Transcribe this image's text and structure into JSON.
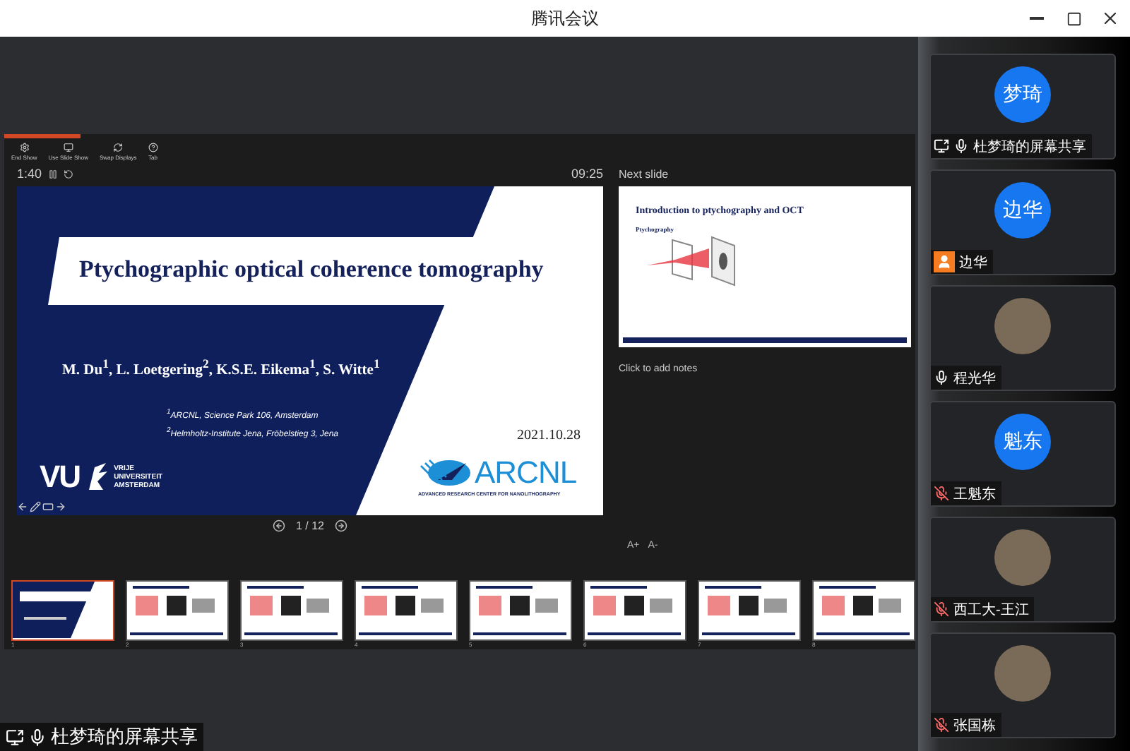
{
  "window": {
    "title": "腾讯会议"
  },
  "presenter": {
    "progress": {
      "level": 0.083
    },
    "toolbar": [
      {
        "label": "End Show",
        "kind": "gear"
      },
      {
        "label": "Use Slide Show",
        "kind": "screen"
      },
      {
        "label": "Swap Displays",
        "kind": "swap"
      },
      {
        "label": "Tab",
        "kind": "info"
      }
    ],
    "elapsed": "1:40",
    "clock": "09:25",
    "slide": {
      "title": "Ptychographic optical coherence tomography",
      "authors": "M. Du$^{1}$, L. Loetgering$^{2}$, K.S.E. Eikema$^{1}$, S. Witte$^{1}$",
      "affiliations": [
        "$^{1}$ARCNL, Science Park 106, Amsterdam",
        "$^{2}$Helmholtz-Institute Jena, Fröbelstieg 3, Jena"
      ],
      "date": "2021.10.28",
      "vu_logo": {
        "mark": "VU",
        "words": [
          "VRIJE",
          "UNIVERSITEIT",
          "AMSTERDAM"
        ]
      },
      "arcnl_logo": {
        "mark": "ARCNL",
        "tagline": "ADVANCED RESEARCH CENTER FOR NANOLITHOGRAPHY"
      }
    },
    "slide_counter": "1 / 12",
    "next_slide": {
      "heading": "Next slide",
      "title": "Introduction to ptychography and OCT",
      "subtitle": "Ptychography"
    },
    "notes": {
      "placeholder": "Click to add notes"
    },
    "text_size_buttons": [
      "A+",
      "A-"
    ],
    "thumbnails": [
      {
        "number": "1",
        "selected": true,
        "kind": "title"
      },
      {
        "number": "2",
        "selected": false,
        "kind": "content"
      },
      {
        "number": "3",
        "selected": false,
        "kind": "content"
      },
      {
        "number": "4",
        "selected": false,
        "kind": "content"
      },
      {
        "number": "5",
        "selected": false,
        "kind": "content"
      },
      {
        "number": "6",
        "selected": false,
        "kind": "content"
      },
      {
        "number": "7",
        "selected": false,
        "kind": "content"
      },
      {
        "number": "8",
        "selected": false,
        "kind": "content"
      }
    ]
  },
  "share_label": {
    "text": "杜梦琦的屏幕共享",
    "sharing": true,
    "muted": false
  },
  "participants": [
    {
      "kind": "avatar",
      "avatar_text": "梦琦",
      "name": "杜梦琦的屏幕共享",
      "sharing": true,
      "muted": false
    },
    {
      "kind": "avatar",
      "avatar_text": "边华",
      "name": "边华",
      "user_badge": true
    },
    {
      "kind": "photo",
      "name": "程光华",
      "muted": false
    },
    {
      "kind": "avatar",
      "avatar_text": "魁东",
      "name": "王魁东",
      "muted": true
    },
    {
      "kind": "photo",
      "name": "西工大-王江",
      "muted": true
    },
    {
      "kind": "photo",
      "name": "张国栋",
      "muted": true
    }
  ]
}
